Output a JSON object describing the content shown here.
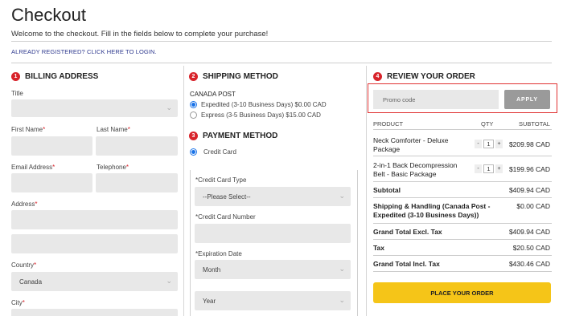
{
  "page": {
    "title": "Checkout",
    "welcome": "Welcome to the checkout. Fill in the fields below to complete your purchase!",
    "login_link": "ALREADY REGISTERED? CLICK HERE TO LOGIN."
  },
  "billing": {
    "step": "1",
    "heading": "BILLING ADDRESS",
    "title_label": "Title",
    "first_name_label": "First Name",
    "last_name_label": "Last Name",
    "email_label": "Email Address",
    "telephone_label": "Telephone",
    "address_label": "Address",
    "country_label": "Country",
    "country_value": "Canada",
    "city_label": "City",
    "required_mark": "*"
  },
  "shipping": {
    "step": "2",
    "heading": "SHIPPING METHOD",
    "carrier": "CANADA POST",
    "options": [
      {
        "label": "Expedited (3-10 Business Days) $0.00 CAD",
        "selected": true
      },
      {
        "label": "Express (3-5 Business Days) $15.00 CAD",
        "selected": false
      }
    ]
  },
  "payment": {
    "step": "3",
    "heading": "PAYMENT METHOD",
    "method": "Credit Card",
    "card_type_label": "Credit Card Type",
    "card_type_value": "--Please Select--",
    "card_number_label": "Credit Card Number",
    "expiration_label": "Expiration Date",
    "month_value": "Month",
    "year_value": "Year",
    "required_mark": "*"
  },
  "review": {
    "step": "4",
    "heading": "REVIEW YOUR ORDER",
    "promo_placeholder": "Promo code",
    "apply_label": "APPLY",
    "col_product": "PRODUCT",
    "col_qty": "QTY",
    "col_subtotal": "SUBTOTAL",
    "items": [
      {
        "name_line1": "Neck Comforter - Deluxe",
        "name_line2": "Package",
        "qty": "1",
        "price": "$209.98 CAD"
      },
      {
        "name_line1": "2-in-1 Back Decompression",
        "name_line2": "Belt - Basic Package",
        "qty": "1",
        "price": "$199.96 CAD"
      }
    ],
    "qty_minus": "-",
    "qty_plus": "+",
    "totals": [
      {
        "label": "Subtotal",
        "label2": "",
        "value": "$409.94 CAD"
      },
      {
        "label": "Shipping & Handling (Canada Post -",
        "label2": "Expedited (3-10 Business Days))",
        "value": "$0.00 CAD"
      },
      {
        "label": "Grand Total Excl. Tax",
        "label2": "",
        "value": "$409.94 CAD"
      },
      {
        "label": "Tax",
        "label2": "",
        "value": "$20.50 CAD"
      },
      {
        "label": "Grand Total Incl. Tax",
        "label2": "",
        "value": "$430.46 CAD"
      }
    ],
    "place_order_label": "PLACE YOUR ORDER"
  },
  "icons": {
    "chevron": "chevron-down-icon"
  },
  "colors": {
    "accent_red": "#d8232a",
    "link_blue": "#2f3a8f",
    "radio_blue": "#1a73e8",
    "place_order_yellow": "#f5c518",
    "field_gray": "#e8e8e8"
  }
}
